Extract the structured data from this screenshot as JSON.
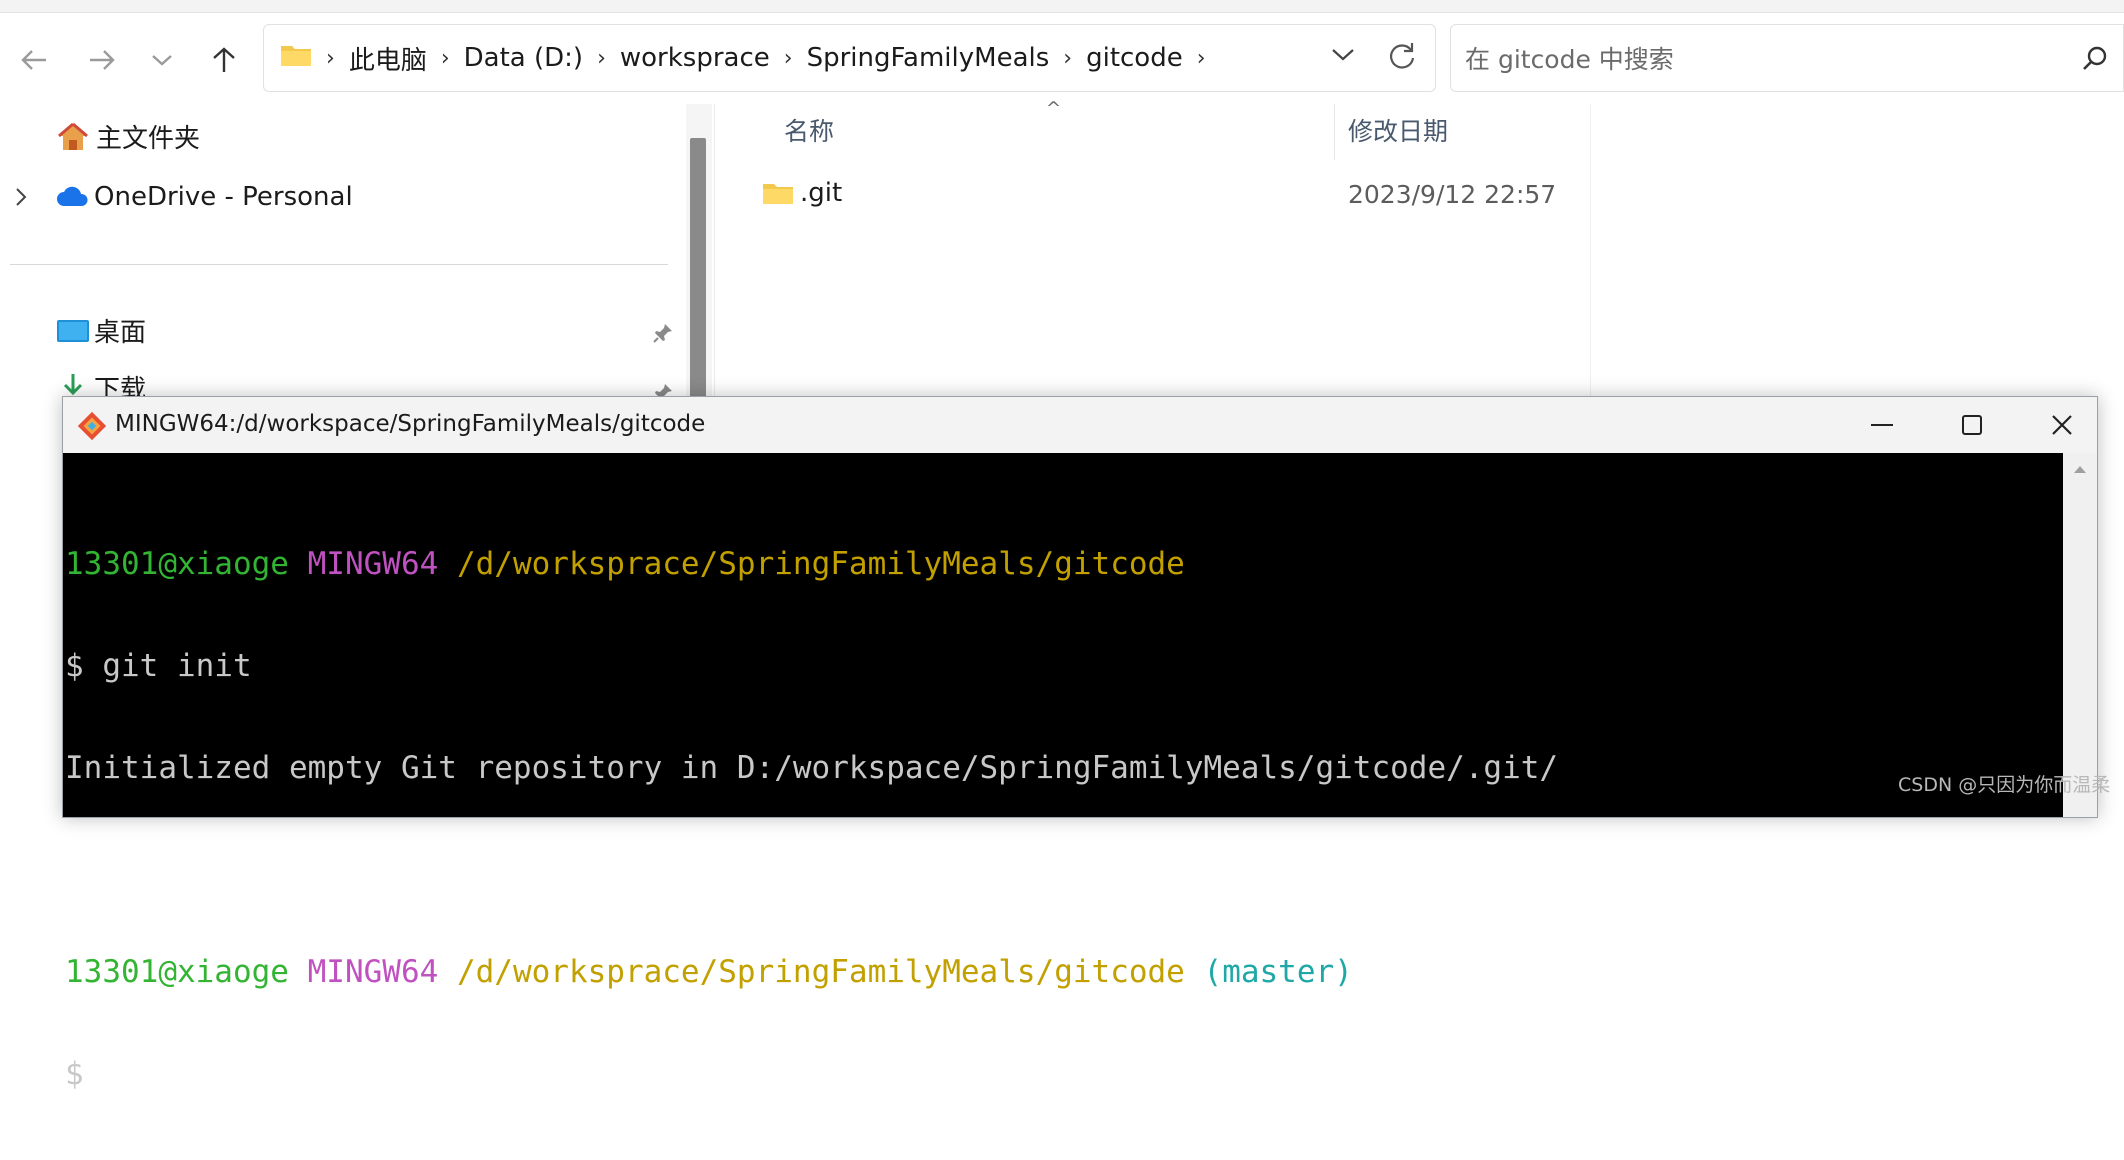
{
  "explorer": {
    "address": {
      "breadcrumbs": [
        "此电脑",
        "Data (D:)",
        "worksprace",
        "SpringFamilyMeals",
        "gitcode"
      ]
    },
    "search": {
      "placeholder": "在 gitcode 中搜索"
    },
    "nav": {
      "home": "主文件夹",
      "onedrive": "OneDrive - Personal",
      "desktop": "桌面",
      "downloads": "下载"
    },
    "columns": {
      "name": "名称",
      "modified": "修改日期"
    },
    "files": [
      {
        "name": ".git",
        "modified": "2023/9/12 22:57",
        "icon": "folder-icon"
      }
    ]
  },
  "terminal": {
    "title": "MINGW64:/d/workspace/SpringFamilyMeals/gitcode",
    "lines": {
      "p1_user": "13301@xiaoge",
      "p1_host": "MINGW64",
      "p1_path": "/d/worksprace/SpringFamilyMeals/gitcode",
      "cmd1": "$ git init",
      "out1": "Initialized empty Git repository in D:/workspace/SpringFamilyMeals/gitcode/.git/",
      "p2_user": "13301@xiaoge",
      "p2_host": "MINGW64",
      "p2_path": "/d/worksprace/SpringFamilyMeals/gitcode",
      "p2_branch": "(master)",
      "cmd2": "$"
    }
  },
  "watermark": "CSDN @只因为你而温柔",
  "colors": {
    "term_green": "#33b433",
    "term_magenta": "#c051c0",
    "term_yellow": "#c2a000",
    "term_cyan": "#20a8a8"
  }
}
